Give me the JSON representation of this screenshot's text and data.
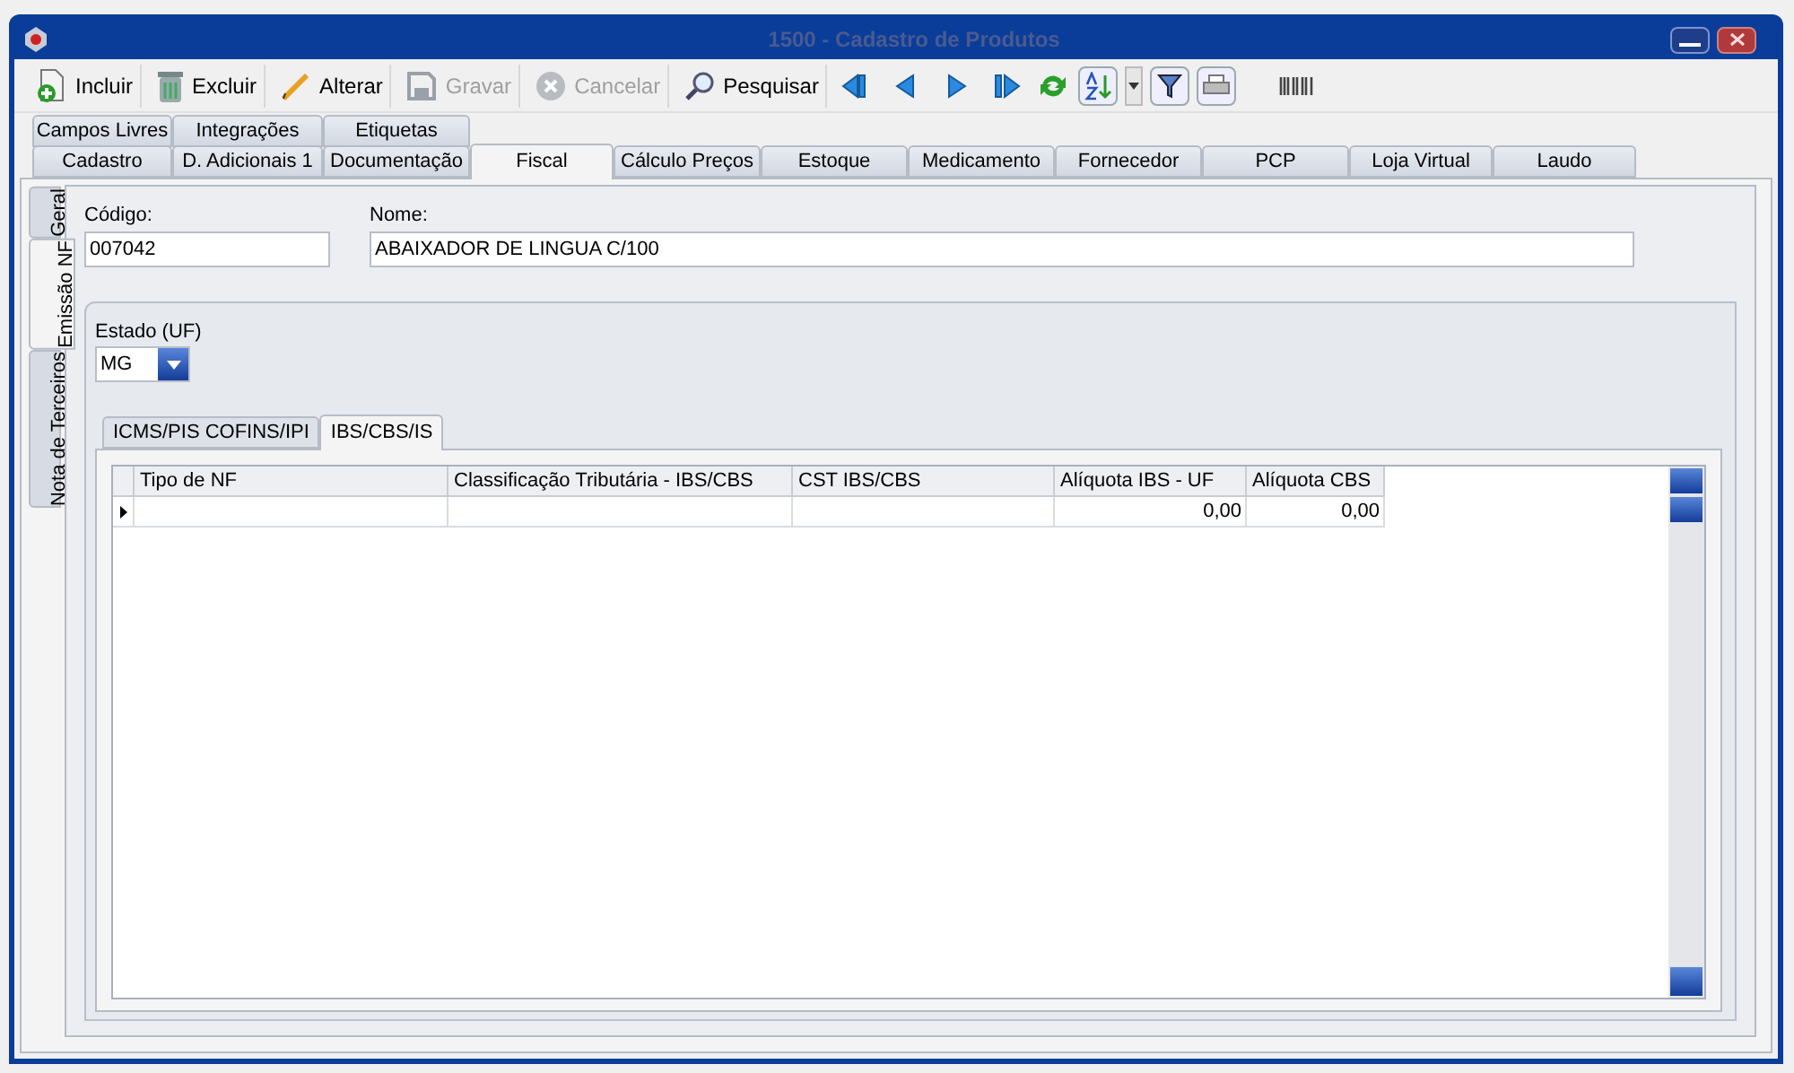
{
  "window": {
    "title": "1500 - Cadastro de Produtos",
    "active": false
  },
  "toolbar": {
    "buttons": [
      {
        "label": "Incluir",
        "kind": "add",
        "disabled": false
      },
      {
        "label": "Excluir",
        "kind": "delete",
        "disabled": false
      },
      {
        "label": "Alterar",
        "kind": "edit",
        "disabled": false
      },
      {
        "label": "Gravar",
        "kind": "save",
        "disabled": true
      },
      {
        "label": "Cancelar",
        "kind": "cancel",
        "disabled": true
      },
      {
        "label": "Pesquisar",
        "kind": "search",
        "disabled": false
      }
    ]
  },
  "tab_rows": [
    [
      {
        "label": "Campos Livres",
        "selected": false
      },
      {
        "label": "Integrações",
        "selected": false
      },
      {
        "label": "Etiquetas",
        "selected": false
      }
    ],
    [
      {
        "label": "Cadastro",
        "selected": false
      },
      {
        "label": "D. Adicionais 1",
        "selected": false
      },
      {
        "label": "Documentação",
        "selected": false
      },
      {
        "label": "Fiscal",
        "selected": true
      },
      {
        "label": "Cálculo Preços",
        "selected": false
      },
      {
        "label": "Estoque",
        "selected": false
      },
      {
        "label": "Medicamento",
        "selected": false
      },
      {
        "label": "Fornecedor",
        "selected": false
      },
      {
        "label": "PCP",
        "selected": false
      },
      {
        "label": "Loja Virtual",
        "selected": false
      },
      {
        "label": "Laudo",
        "selected": false
      }
    ]
  ],
  "side_tabs": [
    {
      "label": "Geral",
      "selected": false
    },
    {
      "label": "Emissão NF",
      "selected": true
    },
    {
      "label": "Nota de Terceiros",
      "selected": false
    }
  ],
  "codigo": {
    "label": "Código:",
    "value": "007042"
  },
  "nome": {
    "label": "Nome:",
    "value": "ABAIXADOR DE LINGUA C/100"
  },
  "estado": {
    "label": "Estado (UF)",
    "value": "MG"
  },
  "sub_tabs": [
    {
      "label": "ICMS/PIS COFINS/IPI",
      "selected": false
    },
    {
      "label": "IBS/CBS/IS",
      "selected": true
    }
  ],
  "grid": {
    "columns": [
      {
        "label": "Tipo de NF",
        "kind": "text"
      },
      {
        "label": "Classificação Tributária - IBS/CBS",
        "kind": "text"
      },
      {
        "label": "CST IBS/CBS",
        "kind": "text"
      },
      {
        "label": "Alíquota IBS - UF",
        "kind": "number"
      },
      {
        "label": "Alíquota CBS",
        "kind": "number"
      }
    ],
    "rows": [
      {
        "current": true,
        "cells": [
          "",
          "",
          "",
          "0,00",
          "0,00"
        ]
      }
    ]
  }
}
